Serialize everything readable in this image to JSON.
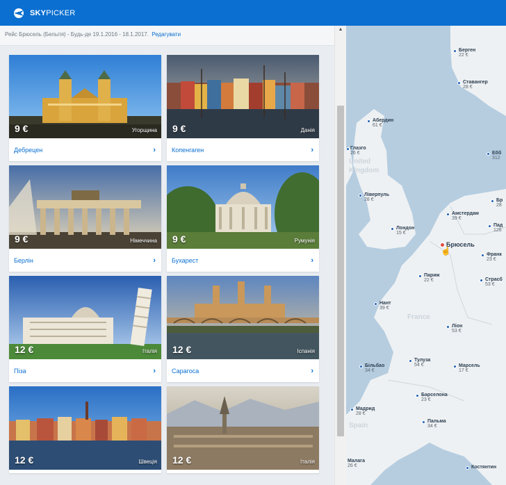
{
  "app": {
    "brand_bold": "SKY",
    "brand_light": "PICKER",
    "logo_icon": "skypicker-logo-icon"
  },
  "search": {
    "summary": "Рейс Брюсель (Бельгія) - Будь-де 19.1.2016 - 18.1.2017.",
    "edit_label": "Редагувати"
  },
  "cards": [
    {
      "price": "9 €",
      "country": "Угорщина",
      "city": "Дебрецен"
    },
    {
      "price": "9 €",
      "country": "Данія",
      "city": "Копенгаген"
    },
    {
      "price": "9 €",
      "country": "Німеччина",
      "city": "Берлін"
    },
    {
      "price": "9 €",
      "country": "Румунія",
      "city": "Бухарест"
    },
    {
      "price": "12 €",
      "country": "Італія",
      "city": "Піза"
    },
    {
      "price": "12 €",
      "country": "Іспанія",
      "city": "Сарагоса"
    },
    {
      "price": "12 €",
      "country": "Швеція",
      "city": ""
    },
    {
      "price": "12 €",
      "country": "Італія",
      "city": ""
    }
  ],
  "chevron": "›",
  "scroll_up": "▲",
  "map": {
    "origin": "Брюсель",
    "country_labels": [
      "United",
      "Kingdom",
      "France",
      "Spain"
    ],
    "pins": [
      {
        "name": "Берген",
        "price": "22 €"
      },
      {
        "name": "Ставангер",
        "price": "28 €"
      },
      {
        "name": "Абердин",
        "price": "61 €"
      },
      {
        "name": "Глазго",
        "price": "26 €"
      },
      {
        "name": "Ліверпуль",
        "price": "28 €"
      },
      {
        "name": "Амстердам",
        "price": "39 €"
      },
      {
        "name": "Лондон",
        "price": "15 €"
      },
      {
        "name": "Париж",
        "price": "22 €"
      },
      {
        "name": "Нант",
        "price": "39 €"
      },
      {
        "name": "Ліон",
        "price": "53 €"
      },
      {
        "name": "Тулуза",
        "price": "54 €"
      },
      {
        "name": "Марсель",
        "price": "17 €"
      },
      {
        "name": "Більбао",
        "price": "34 €"
      },
      {
        "name": "Барселона",
        "price": "23 €"
      },
      {
        "name": "Мадрид",
        "price": "28 €"
      },
      {
        "name": "Пальма",
        "price": "34 €"
      },
      {
        "name": "Малага",
        "price": "26 €"
      },
      {
        "name": "Костянтин",
        "price": ""
      },
      {
        "name": "Страсб",
        "price": "53 €"
      },
      {
        "name": "Франк",
        "price": "23 €"
      },
      {
        "name": "Пад",
        "price": "126"
      },
      {
        "name": "Бр",
        "price": "28"
      },
      {
        "name": "Ебб",
        "price": "312"
      }
    ]
  }
}
